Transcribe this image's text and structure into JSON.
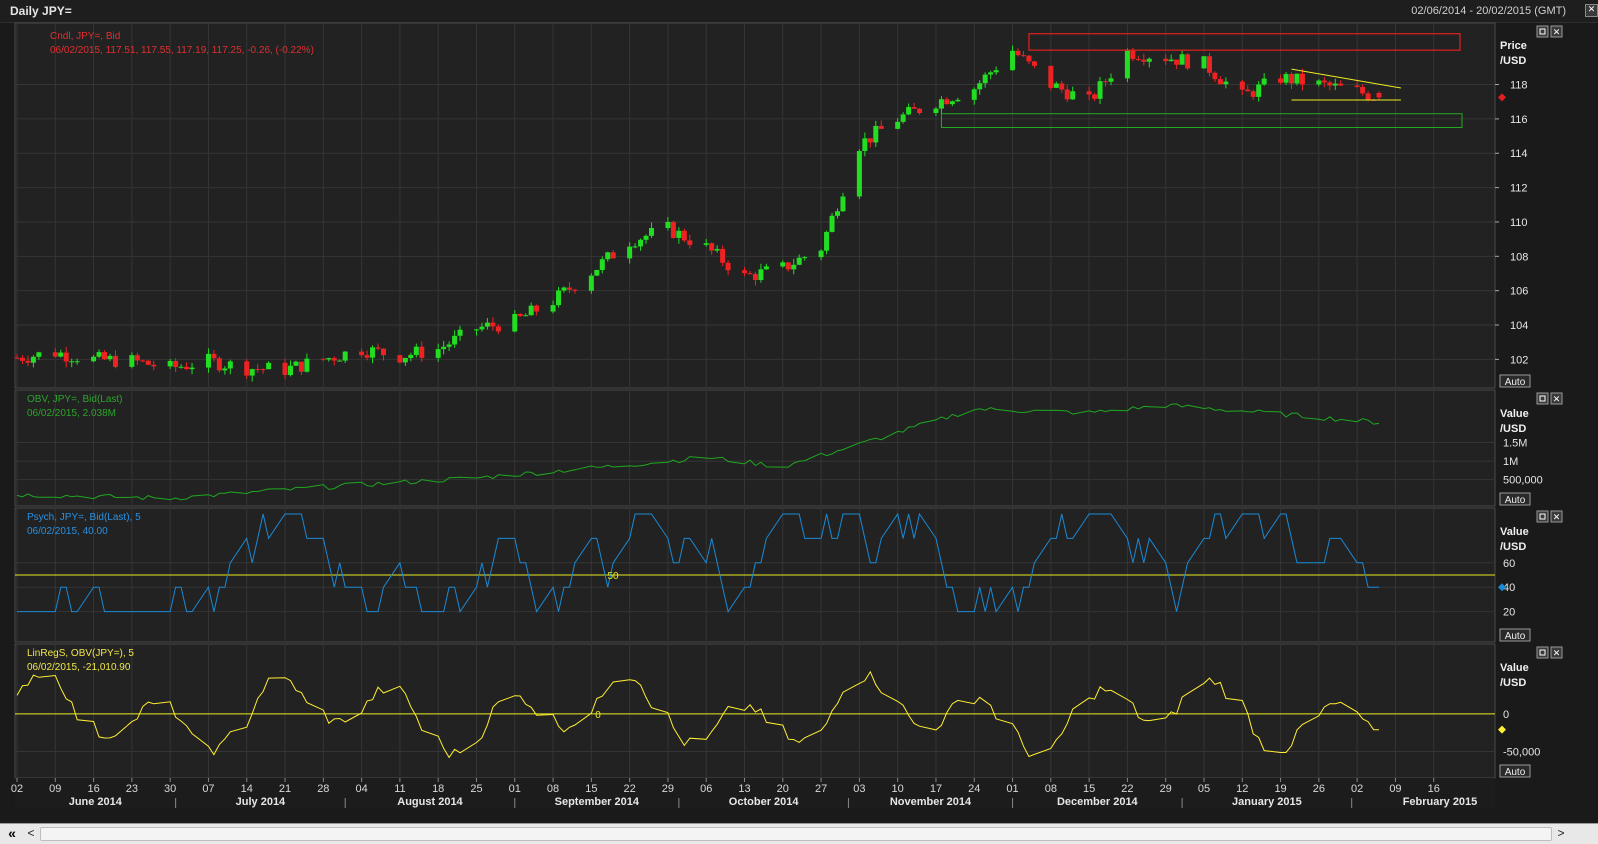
{
  "window": {
    "title": "Daily JPY=",
    "date_range": "02/06/2014 - 20/02/2015 (GMT)"
  },
  "colors": {
    "up": "#22dd22",
    "down": "#ee2222",
    "obv": "#1fa81f",
    "psych": "#1a8ad6",
    "linreg": "#ffee33",
    "grid": "#353535"
  },
  "panels": {
    "price": {
      "legend1": "Cndl, JPY=, Bid",
      "legend2": "06/02/2015, 117.51, 117.55, 117.19, 117.25, -0.26, (-0.22%)",
      "axis_label": "Price",
      "axis_unit": "/USD",
      "auto": "Auto"
    },
    "obv": {
      "legend1": "OBV, JPY=, Bid(Last)",
      "legend2": "06/02/2015, 2.038M",
      "axis_label": "Value",
      "axis_unit": "/USD",
      "auto": "Auto"
    },
    "psych": {
      "legend1": "Psych, JPY=, Bid(Last),  5",
      "legend2": "06/02/2015, 40.00",
      "axis_label": "Value",
      "axis_unit": "/USD",
      "auto": "Auto",
      "ref_label": "50"
    },
    "linreg": {
      "legend1": "LinRegS, OBV(JPY=),  5",
      "legend2": "06/02/2015, -21,010.90",
      "axis_label": "Value",
      "axis_unit": "/USD",
      "auto": "Auto",
      "ref_label": "0"
    }
  },
  "xaxis": {
    "day_labels": [
      "02",
      "09",
      "16",
      "23",
      "30",
      "07",
      "14",
      "21",
      "28",
      "04",
      "11",
      "18",
      "25",
      "01",
      "08",
      "15",
      "22",
      "29",
      "06",
      "13",
      "20",
      "27",
      "03",
      "10",
      "17",
      "24",
      "01",
      "08",
      "15",
      "22",
      "29",
      "05",
      "12",
      "19",
      "26",
      "02",
      "09",
      "16"
    ],
    "month_labels": [
      "June 2014",
      "July 2014",
      "August 2014",
      "September 2014",
      "October 2014",
      "November 2014",
      "December 2014",
      "January 2015",
      "February 2015"
    ]
  },
  "scrollbar": {
    "left_glyph": "«",
    "back_glyph": "<",
    "fwd_glyph": ">"
  },
  "chart_data": [
    {
      "type": "candlestick",
      "title": "Cndl, JPY=, Bid",
      "ylabel": "Price /USD",
      "ylim": [
        100.8,
        121
      ],
      "yticks": [
        102,
        104,
        106,
        108,
        110,
        112,
        114,
        116,
        118
      ],
      "anchors": [
        [
          "2014-06-02",
          102.1
        ],
        [
          "2014-06-09",
          102.4
        ],
        [
          "2014-06-16",
          102.0
        ],
        [
          "2014-06-23",
          101.9
        ],
        [
          "2014-06-30",
          101.5
        ],
        [
          "2014-07-07",
          101.9
        ],
        [
          "2014-07-14",
          101.5
        ],
        [
          "2014-07-21",
          101.4
        ],
        [
          "2014-07-28",
          102.0
        ],
        [
          "2014-08-04",
          102.6
        ],
        [
          "2014-08-11",
          102.2
        ],
        [
          "2014-08-18",
          102.6
        ],
        [
          "2014-08-25",
          103.8
        ],
        [
          "2014-09-01",
          104.2
        ],
        [
          "2014-09-08",
          105.4
        ],
        [
          "2014-09-15",
          107.1
        ],
        [
          "2014-09-22",
          108.9
        ],
        [
          "2014-09-29",
          109.6
        ],
        [
          "2014-10-06",
          108.5
        ],
        [
          "2014-10-13",
          106.8
        ],
        [
          "2014-10-20",
          107.3
        ],
        [
          "2014-10-27",
          108.5
        ],
        [
          "2014-11-03",
          114.5
        ],
        [
          "2014-11-10",
          116.0
        ],
        [
          "2014-11-17",
          117.0
        ],
        [
          "2014-11-24",
          117.8
        ],
        [
          "2014-12-01",
          120.0
        ],
        [
          "2014-12-08",
          118.0
        ],
        [
          "2014-12-15",
          117.0
        ],
        [
          "2014-12-22",
          119.9
        ],
        [
          "2014-12-29",
          119.6
        ],
        [
          "2015-01-05",
          119.2
        ],
        [
          "2015-01-12",
          117.3
        ],
        [
          "2015-01-19",
          118.4
        ],
        [
          "2015-01-26",
          118.0
        ],
        [
          "2015-02-02",
          117.6
        ],
        [
          "2015-02-06",
          117.25
        ]
      ],
      "last": {
        "open": 117.51,
        "high": 117.55,
        "low": 117.19,
        "close": 117.25
      },
      "annotations": {
        "red_resistance": [
          120.9,
          120.0
        ],
        "green_support": [
          116.3,
          115.5
        ],
        "triangle_top": [
          [
            "2015-01-21",
            118.9
          ],
          [
            "2015-02-10",
            117.8
          ]
        ],
        "triangle_bottom": [
          [
            "2015-01-21",
            117.1
          ],
          [
            "2015-02-10",
            117.1
          ]
        ]
      }
    },
    {
      "type": "line",
      "title": "OBV, JPY=, Bid(Last)",
      "ylabel": "Value /USD",
      "ylim": [
        -100000,
        2750000
      ],
      "yticks": [
        500000,
        1000000,
        1500000
      ],
      "ytick_labels": [
        "500,000",
        "1M",
        "1.5M"
      ],
      "anchors": [
        [
          "2014-06-02",
          100000
        ],
        [
          "2014-06-30",
          0
        ],
        [
          "2014-07-28",
          300000
        ],
        [
          "2014-08-25",
          550000
        ],
        [
          "2014-09-22",
          900000
        ],
        [
          "2014-10-06",
          1100000
        ],
        [
          "2014-10-20",
          850000
        ],
        [
          "2014-11-03",
          1450000
        ],
        [
          "2014-11-24",
          2400000
        ],
        [
          "2014-12-15",
          2300000
        ],
        [
          "2014-12-29",
          2500000
        ],
        [
          "2015-01-12",
          2350000
        ],
        [
          "2015-02-06",
          2038000
        ]
      ]
    },
    {
      "type": "line",
      "title": "Psych, JPY=, Bid(Last), 5",
      "ylabel": "Value /USD",
      "ylim": [
        0,
        100
      ],
      "yticks": [
        20,
        40,
        60
      ],
      "reference_line": 50,
      "last_value": 40
    },
    {
      "type": "line",
      "title": "LinRegS, OBV(JPY=), 5",
      "ylabel": "Value /USD",
      "ylim": [
        -80000,
        85000
      ],
      "yticks": [
        -50000,
        0
      ],
      "ytick_labels": [
        "-50,000",
        "0"
      ],
      "reference_line": 0,
      "last_value": -21010.9
    }
  ]
}
